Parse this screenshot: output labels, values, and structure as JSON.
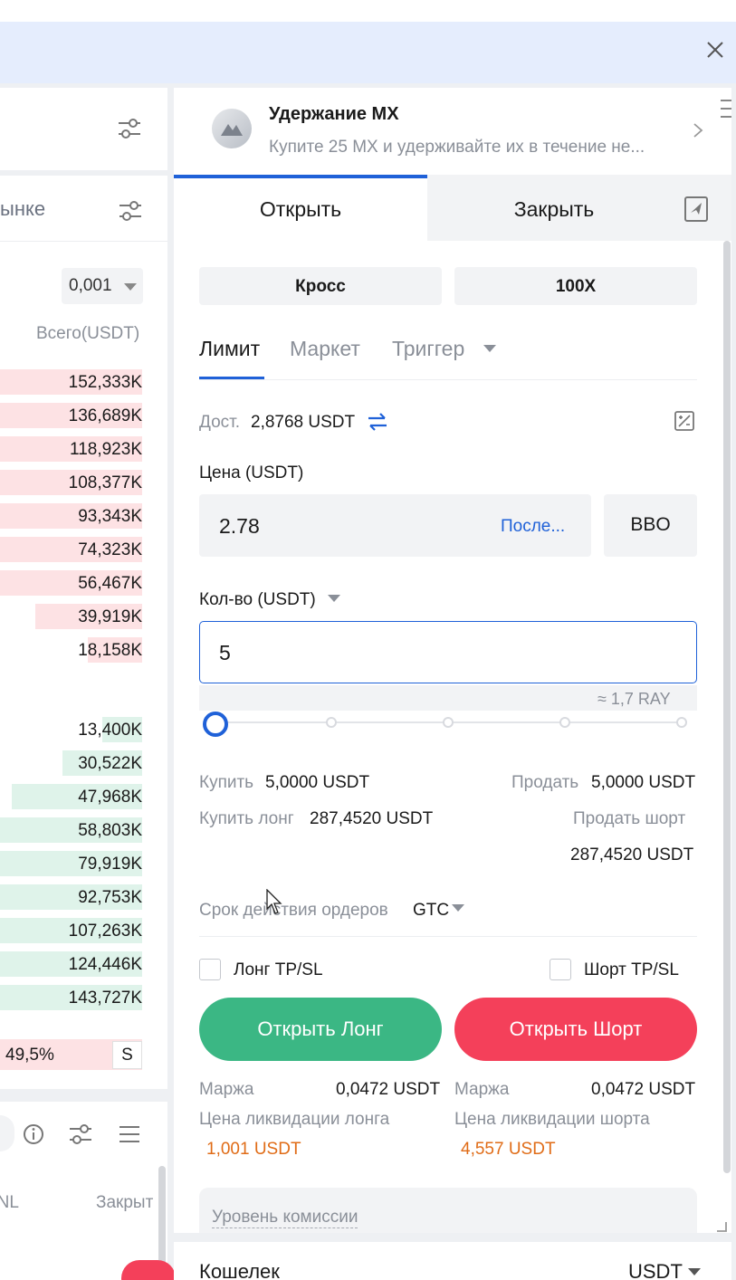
{
  "left_panel": {
    "section_label": "ынке",
    "precision": "0,001",
    "total_header": "Всего(USDT)",
    "asks": [
      {
        "value": "152,333K",
        "fill": 1.0
      },
      {
        "value": "136,689K",
        "fill": 1.0
      },
      {
        "value": "118,923K",
        "fill": 1.0
      },
      {
        "value": "108,377K",
        "fill": 1.0
      },
      {
        "value": "93,343K",
        "fill": 1.0
      },
      {
        "value": "74,323K",
        "fill": 1.0
      },
      {
        "value": "56,467K",
        "fill": 1.0
      },
      {
        "value": "39,919K",
        "fill": 0.75
      },
      {
        "value": "18,158K",
        "fill": 0.38
      }
    ],
    "bids": [
      {
        "value": "13,400K",
        "fill": 0.28
      },
      {
        "value": "30,522K",
        "fill": 0.56
      },
      {
        "value": "47,968K",
        "fill": 0.92
      },
      {
        "value": "58,803K",
        "fill": 1.0
      },
      {
        "value": "79,919K",
        "fill": 1.0
      },
      {
        "value": "92,753K",
        "fill": 1.0
      },
      {
        "value": "107,263K",
        "fill": 1.0
      },
      {
        "value": "124,446K",
        "fill": 1.0
      },
      {
        "value": "143,727K",
        "fill": 1.0
      }
    ],
    "ratio_pct": "49,5%",
    "ratio_side": "S",
    "col_pnl": "PNL",
    "col_close": "Закрыт"
  },
  "promo": {
    "title": "Удержание MX",
    "description": "Купите 25 MX и удерживайте их в течение не..."
  },
  "tabs": {
    "open": "Открыть",
    "close": "Закрыть"
  },
  "mode": {
    "margin": "Кросс",
    "leverage": "100X"
  },
  "order_types": {
    "limit": "Лимит",
    "market": "Маркет",
    "trigger": "Триггер"
  },
  "available": {
    "label": "Дост.",
    "value": "2,8768 USDT"
  },
  "price": {
    "label": "Цена (USDT)",
    "value": "2.78",
    "last": "После...",
    "bbo": "BBO"
  },
  "quantity": {
    "label": "Кол-во (USDT)",
    "value": "5",
    "approx": "≈ 1,7 RAY",
    "slider_fraction": 0
  },
  "summary": {
    "buy_label": "Купить",
    "buy_value": "5,0000 USDT",
    "sell_label": "Продать",
    "sell_value": "5,0000 USDT",
    "buy_long_label": "Купить лонг",
    "buy_long_value": "287,4520 USDT",
    "sell_short_label": "Продать шорт",
    "sell_short_value": "287,4520 USDT"
  },
  "tif": {
    "label": "Срок действия ордеров",
    "value": "GTC"
  },
  "tpsl": {
    "long": "Лонг TP/SL",
    "short": "Шорт TP/SL"
  },
  "actions": {
    "open_long": "Открыть Лонг",
    "open_short": "Открыть Шорт"
  },
  "margin_info": {
    "long_margin_label": "Маржа",
    "long_margin_value": "0,0472 USDT",
    "short_margin_label": "Маржа",
    "short_margin_value": "0,0472 USDT",
    "long_liq_label": "Цена ликвидации лонга",
    "long_liq_value": "1,001 USDT",
    "short_liq_label": "Цена ликвидации шорта",
    "short_liq_value": "4,557 USDT"
  },
  "fee": {
    "label": "Уровень комиссии"
  },
  "wallet": {
    "label": "Кошелек",
    "currency": "USDT"
  },
  "colors": {
    "accent": "#1f61d8",
    "long": "#3bb784",
    "short": "#f4405a",
    "ask_bar": "#fde2e4",
    "bid_bar": "#dff3ea",
    "liquidation": "#e06c17"
  }
}
